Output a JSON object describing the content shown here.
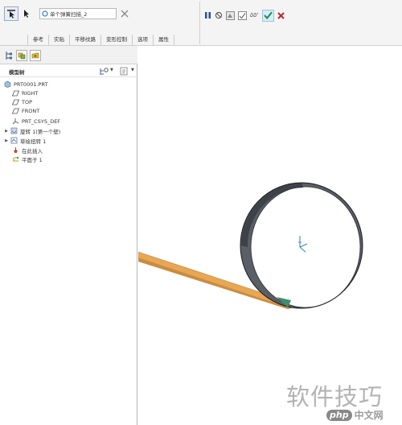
{
  "ribbon": {
    "sweep_field": "单个弹簧扫描_2",
    "tabs": [
      "参考",
      "实贴",
      "平移纹路",
      "变形控制",
      "选项",
      "属性"
    ],
    "geometry_check": "δδ'"
  },
  "tree": {
    "title": "模型树",
    "items": [
      {
        "label": "PRT0001.PRT",
        "icon": "part-icon",
        "indent": 0,
        "expand": ""
      },
      {
        "label": "RIGHT",
        "icon": "datum-plane-icon",
        "indent": 1,
        "expand": ""
      },
      {
        "label": "TOP",
        "icon": "datum-plane-icon",
        "indent": 1,
        "expand": ""
      },
      {
        "label": "FRONT",
        "icon": "datum-plane-icon",
        "indent": 1,
        "expand": ""
      },
      {
        "label": "PRT_CSYS_DEF",
        "icon": "csys-icon",
        "indent": 1,
        "expand": ""
      },
      {
        "label": "旋转 1(第一个壁)",
        "icon": "revolve-icon",
        "indent": 1,
        "expand": "▶"
      },
      {
        "label": "草绘扭转 1",
        "icon": "sketch-icon",
        "indent": 1,
        "expand": "▶"
      },
      {
        "label": "在此插入",
        "icon": "insert-here-icon",
        "indent": 1,
        "expand": ""
      },
      {
        "label": "平面于 1",
        "icon": "flat-icon",
        "indent": 1,
        "expand": ""
      }
    ]
  },
  "watermark": {
    "text": "软件技巧",
    "logo_php": "php",
    "logo_cn": "中文网"
  },
  "colors": {
    "strip": "#e6a85e",
    "strip_edge": "#c48536",
    "ring": "#4a4d55",
    "ring_edge": "#1c1d22",
    "accent": "#2e7bbf"
  }
}
